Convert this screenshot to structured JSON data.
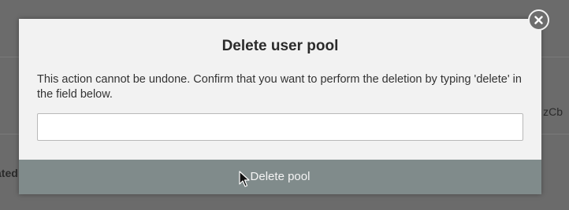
{
  "background": {
    "left_fragment": "ated",
    "right_fragment": "zCb"
  },
  "modal": {
    "title": "Delete user pool",
    "message": "This action cannot be undone. Confirm that you want to perform the deletion by typing 'delete' in the field below.",
    "input": {
      "value": "",
      "placeholder": ""
    },
    "delete_button_label": "Delete pool",
    "close_icon": "close-icon"
  },
  "colors": {
    "modal_background": "#f2f2f2",
    "button_background": "#808b8b",
    "overlay": "#6b6b6b"
  }
}
